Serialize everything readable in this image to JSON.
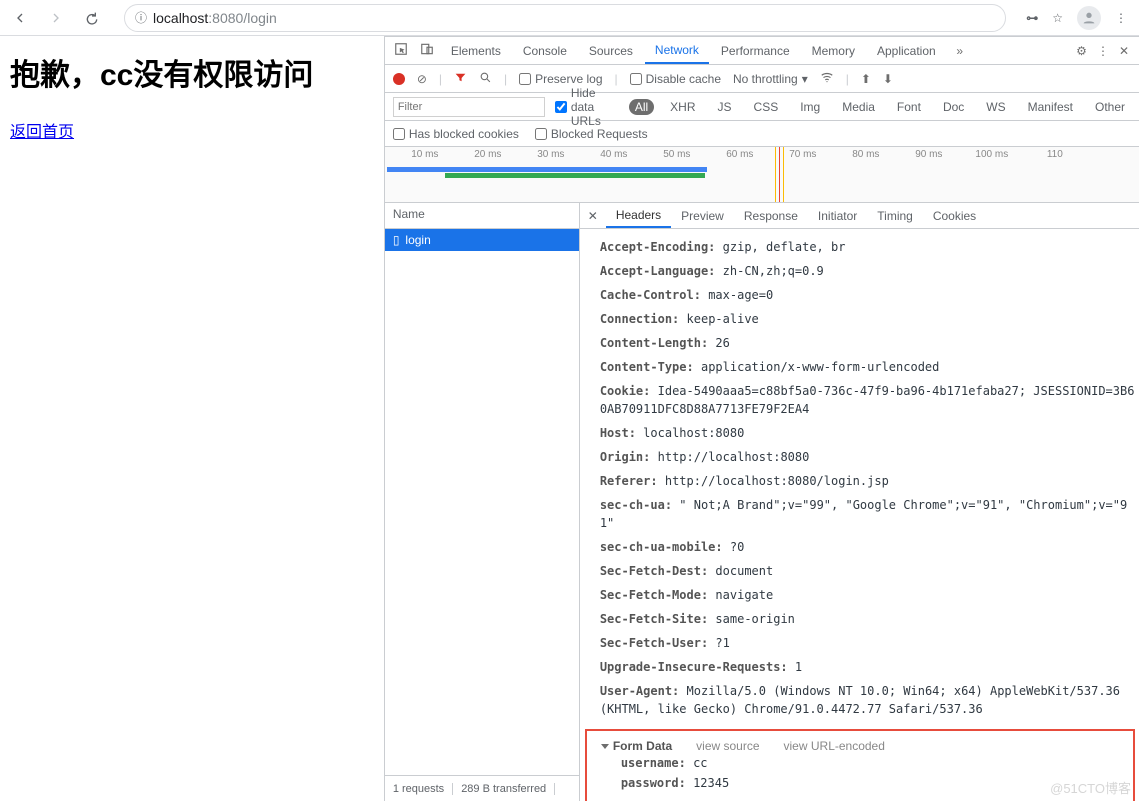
{
  "browser": {
    "url_host": "localhost",
    "url_port_path": ":8080/login"
  },
  "page": {
    "heading": "抱歉，cc没有权限访问",
    "back_link": "返回首页"
  },
  "devtools": {
    "tabs": [
      "Elements",
      "Console",
      "Sources",
      "Network",
      "Performance",
      "Memory",
      "Application"
    ],
    "active_tab": "Network",
    "net_toolbar": {
      "preserve_log": "Preserve log",
      "disable_cache": "Disable cache",
      "throttling": "No throttling"
    },
    "filter": {
      "placeholder": "Filter",
      "hide_data_urls": "Hide data URLs",
      "types": [
        "All",
        "XHR",
        "JS",
        "CSS",
        "Img",
        "Media",
        "Font",
        "Doc",
        "WS",
        "Manifest",
        "Other"
      ],
      "has_blocked_cookies": "Has blocked cookies",
      "blocked_requests": "Blocked Requests"
    },
    "timeline_ticks": [
      "10 ms",
      "20 ms",
      "30 ms",
      "40 ms",
      "50 ms",
      "60 ms",
      "70 ms",
      "80 ms",
      "90 ms",
      "100 ms",
      "110"
    ],
    "requests": {
      "col_name": "Name",
      "items": [
        "login"
      ],
      "footer_requests": "1 requests",
      "footer_transferred": "289 B transferred"
    },
    "detail_tabs": [
      "Headers",
      "Preview",
      "Response",
      "Initiator",
      "Timing",
      "Cookies"
    ],
    "active_detail_tab": "Headers",
    "headers": [
      {
        "k": "Accept-Encoding:",
        "v": "gzip, deflate, br"
      },
      {
        "k": "Accept-Language:",
        "v": "zh-CN,zh;q=0.9"
      },
      {
        "k": "Cache-Control:",
        "v": "max-age=0"
      },
      {
        "k": "Connection:",
        "v": "keep-alive"
      },
      {
        "k": "Content-Length:",
        "v": "26"
      },
      {
        "k": "Content-Type:",
        "v": "application/x-www-form-urlencoded"
      },
      {
        "k": "Cookie:",
        "v": "Idea-5490aaa5=c88bf5a0-736c-47f9-ba96-4b171efaba27; JSESSIONID=3B60AB70911DFC8D88A7713FE79F2EA4"
      },
      {
        "k": "Host:",
        "v": "localhost:8080"
      },
      {
        "k": "Origin:",
        "v": "http://localhost:8080"
      },
      {
        "k": "Referer:",
        "v": "http://localhost:8080/login.jsp"
      },
      {
        "k": "sec-ch-ua:",
        "v": "\" Not;A Brand\";v=\"99\", \"Google Chrome\";v=\"91\", \"Chromium\";v=\"91\""
      },
      {
        "k": "sec-ch-ua-mobile:",
        "v": "?0"
      },
      {
        "k": "Sec-Fetch-Dest:",
        "v": "document"
      },
      {
        "k": "Sec-Fetch-Mode:",
        "v": "navigate"
      },
      {
        "k": "Sec-Fetch-Site:",
        "v": "same-origin"
      },
      {
        "k": "Sec-Fetch-User:",
        "v": "?1"
      },
      {
        "k": "Upgrade-Insecure-Requests:",
        "v": "1"
      },
      {
        "k": "User-Agent:",
        "v": "Mozilla/5.0 (Windows NT 10.0; Win64; x64) AppleWebKit/537.36 (KHTML, like Gecko) Chrome/91.0.4472.77 Safari/537.36"
      }
    ],
    "form_data": {
      "title": "Form Data",
      "view_source": "view source",
      "view_url_encoded": "view URL-encoded",
      "fields": [
        {
          "k": "username:",
          "v": "cc"
        },
        {
          "k": "password:",
          "v": "12345"
        }
      ]
    }
  },
  "watermark": "@51CTO博客"
}
